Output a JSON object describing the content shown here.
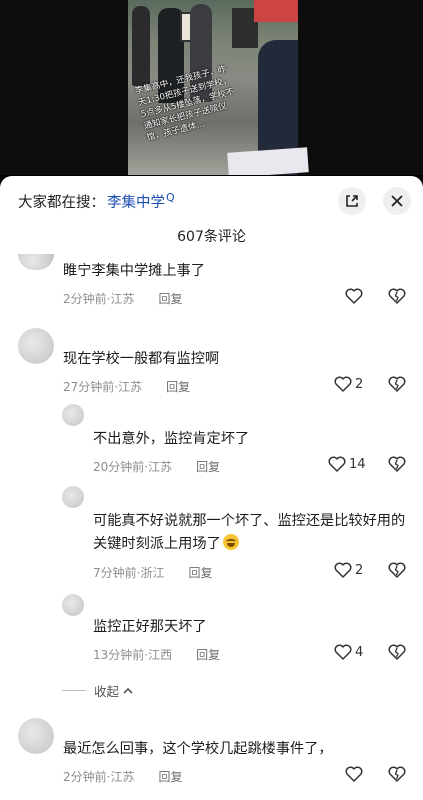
{
  "video": {
    "overlay_text": "李集高中，还我孩子，昨天1:30把孩子送到学校，5点多从5楼坠落，学校不通知家长把孩子送殡仪馆，孩子遗体…"
  },
  "search": {
    "prefix": "大家都在搜：",
    "keyword": "李集中学",
    "suffix": "Q"
  },
  "comment_count": "607条评论",
  "comments": [
    {
      "text": "睢宁李集中学摊上事了",
      "time": "2分钟前",
      "location": "江苏",
      "reply": "回复",
      "likes": ""
    },
    {
      "text": "现在学校一般都有监控啊",
      "time": "27分钟前",
      "location": "江苏",
      "reply": "回复",
      "likes": "2"
    },
    {
      "text": "不出意外，监控肯定坏了",
      "time": "20分钟前",
      "location": "江苏",
      "reply": "回复",
      "likes": "14"
    },
    {
      "text": "可能真不好说就那一个坏了、监控还是比较好用的关键时刻派上用场了",
      "time": "7分钟前",
      "location": "浙江",
      "reply": "回复",
      "likes": "2"
    },
    {
      "text": "监控正好那天坏了",
      "time": "13分钟前",
      "location": "江西",
      "reply": "回复",
      "likes": "4"
    },
    {
      "text": "最近怎么回事，这个学校几起跳楼事件了，",
      "time": "2分钟前",
      "location": "江苏",
      "reply": "回复",
      "likes": ""
    }
  ],
  "collapse_label": "收起",
  "icons": {
    "expand": "expand-icon",
    "close": "close-icon",
    "like": "heart-outline-icon",
    "dislike": "broken-heart-icon",
    "chevron": "chevron-up-icon"
  }
}
